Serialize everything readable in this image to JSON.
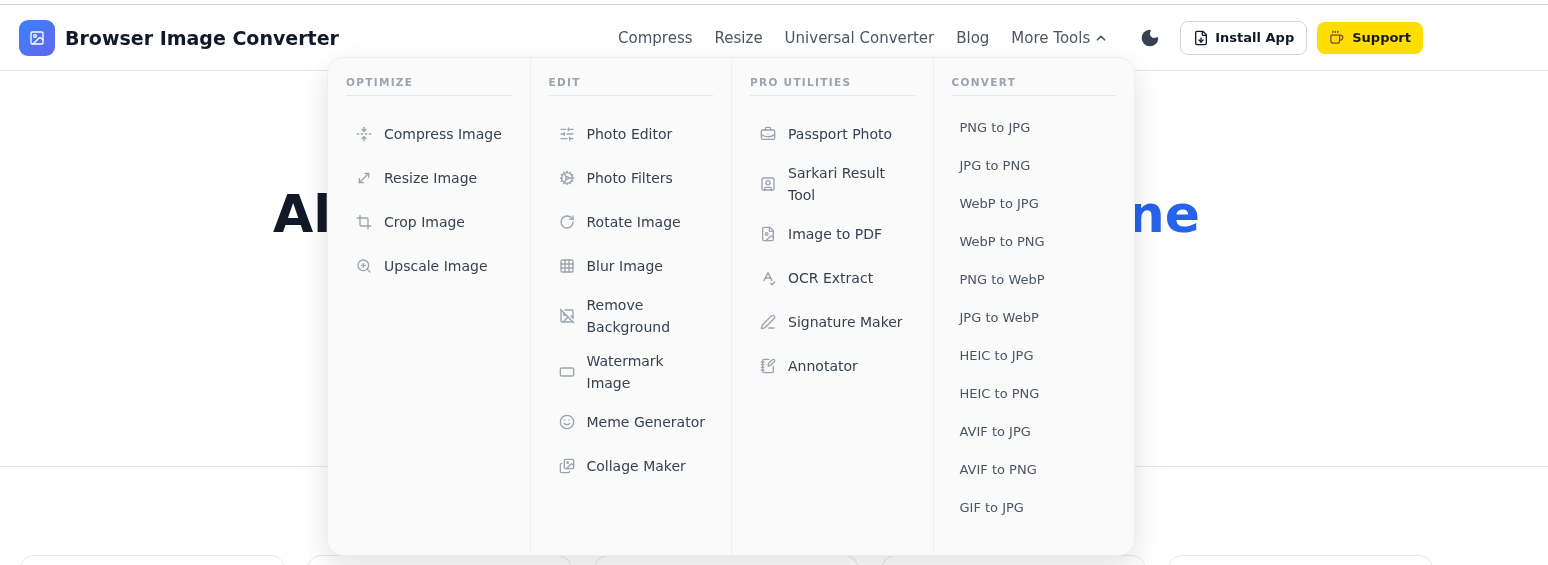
{
  "header": {
    "brand": "Browser Image Converter",
    "nav": [
      {
        "label": "Compress"
      },
      {
        "label": "Resize"
      },
      {
        "label": "Universal Converter"
      },
      {
        "label": "Blog"
      },
      {
        "label": "More Tools",
        "expanded": true
      }
    ],
    "install_button": "Install App",
    "support_button": "Support"
  },
  "hero": {
    "title_start": "Al",
    "title_end": "ne"
  },
  "menu": {
    "columns": [
      {
        "heading": "OPTIMIZE",
        "kind": "icons",
        "items": [
          "Compress Image",
          "Resize Image",
          "Crop Image",
          "Upscale Image"
        ]
      },
      {
        "heading": "EDIT",
        "kind": "icons",
        "items": [
          "Photo Editor",
          "Photo Filters",
          "Rotate Image",
          "Blur Image",
          "Remove Background",
          "Watermark Image",
          "Meme Generator",
          "Collage Maker"
        ]
      },
      {
        "heading": "PRO UTILITIES",
        "kind": "icons",
        "items": [
          "Passport Photo",
          "Sarkari Result Tool",
          "Image to PDF",
          "OCR Extract",
          "Signature Maker",
          "Annotator"
        ]
      },
      {
        "heading": "CONVERT",
        "kind": "plain",
        "items": [
          "PNG to JPG",
          "JPG to PNG",
          "WebP to JPG",
          "WebP to PNG",
          "PNG to WebP",
          "JPG to WebP",
          "HEIC to JPG",
          "HEIC to PNG",
          "AVIF to JPG",
          "AVIF to PNG",
          "GIF to JPG"
        ]
      }
    ]
  }
}
